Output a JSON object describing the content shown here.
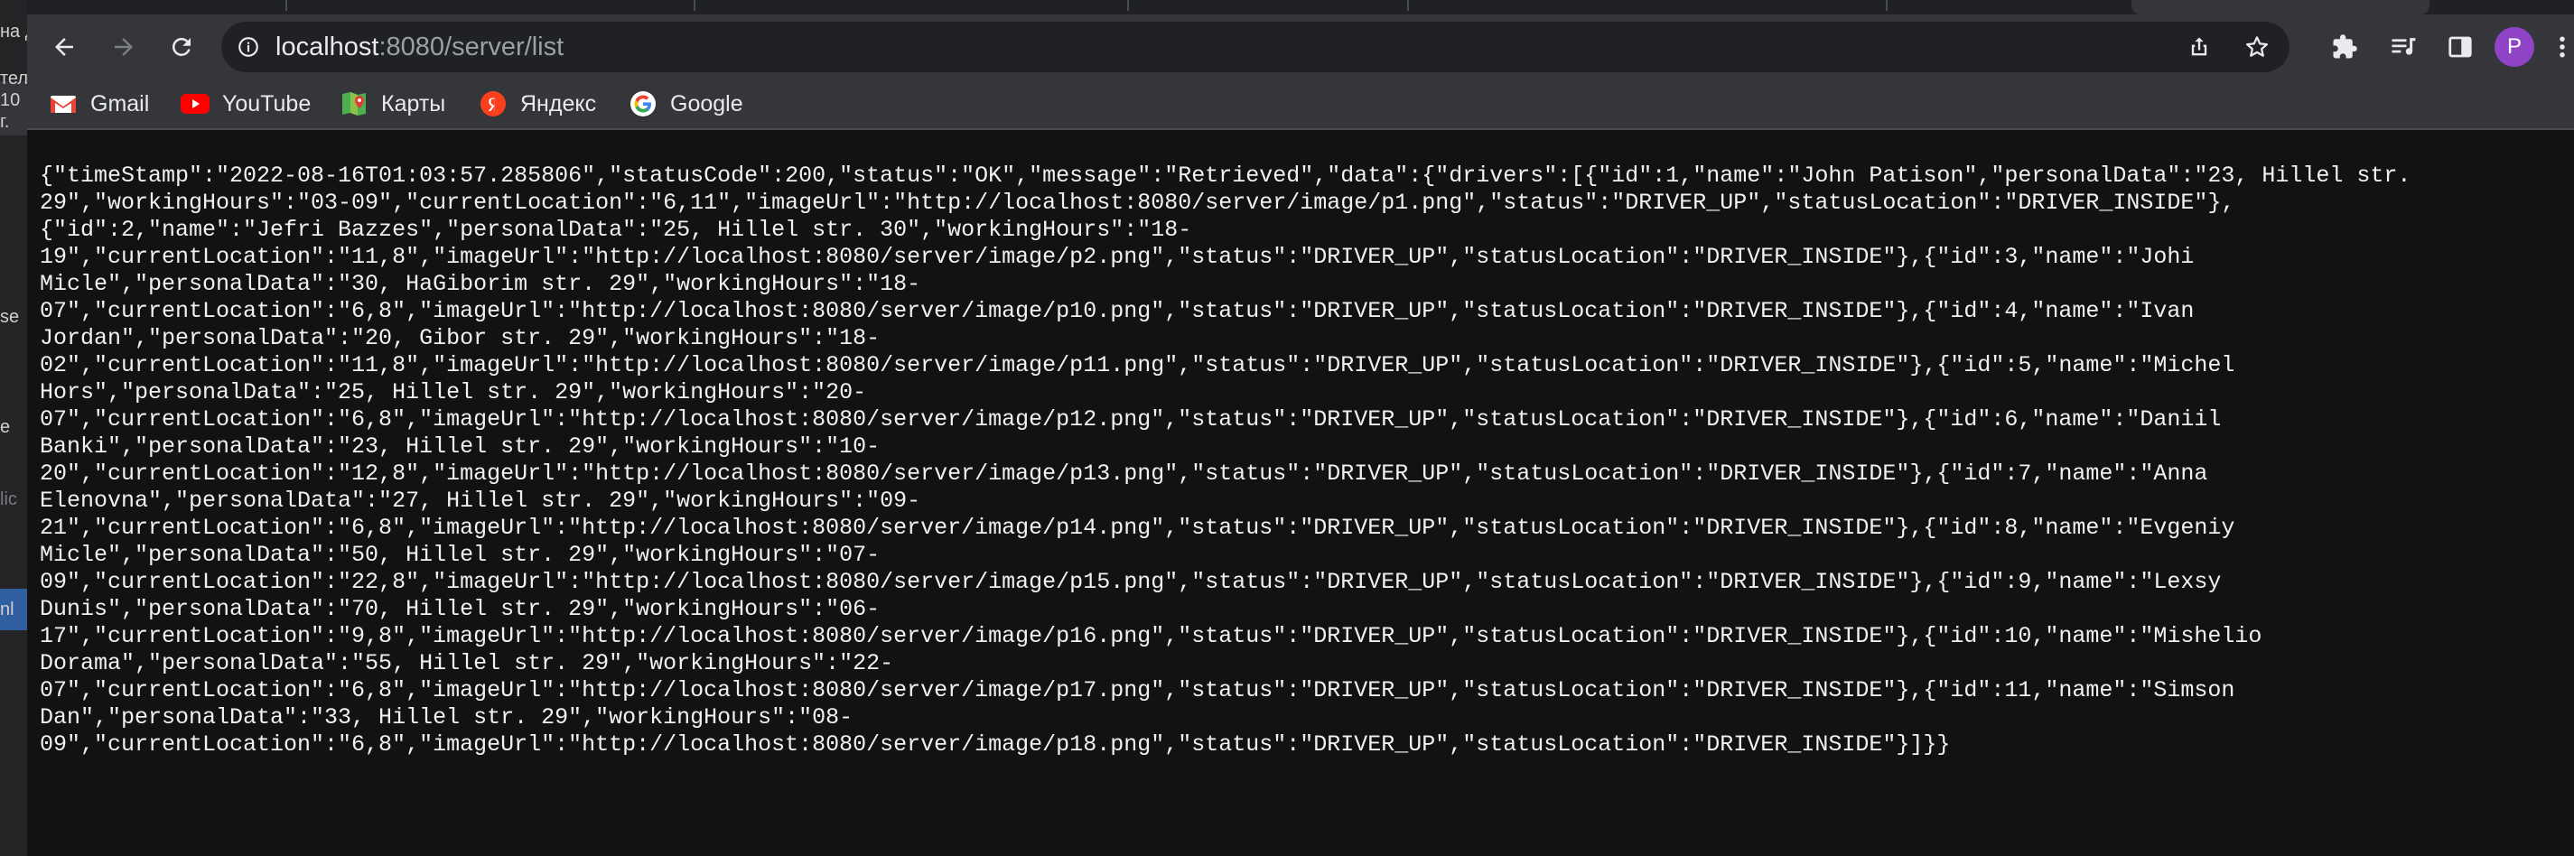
{
  "left_window_fragments": [
    "на д",
    "тел",
    "10",
    "г.",
    "se",
    "e",
    "lic",
    "nl"
  ],
  "browser": {
    "url_host": "localhost",
    "url_rest": ":8080/server/list",
    "profile_initial": "P",
    "toolbar_icons": [
      "back-icon",
      "forward-icon",
      "reload-icon",
      "site-info-icon",
      "share-icon",
      "bookmark-star-icon",
      "extensions-icon",
      "media-control-icon",
      "side-panel-icon",
      "profile-avatar",
      "menu-icon"
    ],
    "colors": {
      "toolbar": "#35363a",
      "omnibox": "#202124",
      "page": "#121212",
      "avatar": "#8e44c4"
    }
  },
  "bookmarks": [
    {
      "label": "Gmail",
      "icon": "gmail-icon"
    },
    {
      "label": "YouTube",
      "icon": "youtube-icon"
    },
    {
      "label": "Карты",
      "icon": "maps-icon"
    },
    {
      "label": "Яндекс",
      "icon": "yandex-icon"
    },
    {
      "label": "Google",
      "icon": "google-icon"
    }
  ],
  "json_lines": [
    "{\"timeStamp\":\"2022-08-16T01:03:57.285806\",\"statusCode\":200,\"status\":\"OK\",\"message\":\"Retrieved\",\"data\":{\"drivers\":[{\"id\":1,\"name\":\"John Patison\",\"personalData\":\"23, Hillel str.",
    "29\",\"workingHours\":\"03-09\",\"currentLocation\":\"6,11\",\"imageUrl\":\"http://localhost:8080/server/image/p1.png\",\"status\":\"DRIVER_UP\",\"statusLocation\":\"DRIVER_INSIDE\"},",
    "{\"id\":2,\"name\":\"Jefri Bazzes\",\"personalData\":\"25, Hillel str. 30\",\"workingHours\":\"18-",
    "19\",\"currentLocation\":\"11,8\",\"imageUrl\":\"http://localhost:8080/server/image/p2.png\",\"status\":\"DRIVER_UP\",\"statusLocation\":\"DRIVER_INSIDE\"},{\"id\":3,\"name\":\"Johi",
    "Micle\",\"personalData\":\"30, HaGiborim str. 29\",\"workingHours\":\"18-",
    "07\",\"currentLocation\":\"6,8\",\"imageUrl\":\"http://localhost:8080/server/image/p10.png\",\"status\":\"DRIVER_UP\",\"statusLocation\":\"DRIVER_INSIDE\"},{\"id\":4,\"name\":\"Ivan",
    "Jordan\",\"personalData\":\"20, Gibor str. 29\",\"workingHours\":\"18-",
    "02\",\"currentLocation\":\"11,8\",\"imageUrl\":\"http://localhost:8080/server/image/p11.png\",\"status\":\"DRIVER_UP\",\"statusLocation\":\"DRIVER_INSIDE\"},{\"id\":5,\"name\":\"Michel",
    "Hors\",\"personalData\":\"25, Hillel str. 29\",\"workingHours\":\"20-",
    "07\",\"currentLocation\":\"6,8\",\"imageUrl\":\"http://localhost:8080/server/image/p12.png\",\"status\":\"DRIVER_UP\",\"statusLocation\":\"DRIVER_INSIDE\"},{\"id\":6,\"name\":\"Daniil",
    "Banki\",\"personalData\":\"23, Hillel str. 29\",\"workingHours\":\"10-",
    "20\",\"currentLocation\":\"12,8\",\"imageUrl\":\"http://localhost:8080/server/image/p13.png\",\"status\":\"DRIVER_UP\",\"statusLocation\":\"DRIVER_INSIDE\"},{\"id\":7,\"name\":\"Anna",
    "Elenovna\",\"personalData\":\"27, Hillel str. 29\",\"workingHours\":\"09-",
    "21\",\"currentLocation\":\"6,8\",\"imageUrl\":\"http://localhost:8080/server/image/p14.png\",\"status\":\"DRIVER_UP\",\"statusLocation\":\"DRIVER_INSIDE\"},{\"id\":8,\"name\":\"Evgeniy",
    "Micle\",\"personalData\":\"50, Hillel str. 29\",\"workingHours\":\"07-",
    "09\",\"currentLocation\":\"22,8\",\"imageUrl\":\"http://localhost:8080/server/image/p15.png\",\"status\":\"DRIVER_UP\",\"statusLocation\":\"DRIVER_INSIDE\"},{\"id\":9,\"name\":\"Lexsy",
    "Dunis\",\"personalData\":\"70, Hillel str. 29\",\"workingHours\":\"06-",
    "17\",\"currentLocation\":\"9,8\",\"imageUrl\":\"http://localhost:8080/server/image/p16.png\",\"status\":\"DRIVER_UP\",\"statusLocation\":\"DRIVER_INSIDE\"},{\"id\":10,\"name\":\"Mishelio",
    "Dorama\",\"personalData\":\"55, Hillel str. 29\",\"workingHours\":\"22-",
    "07\",\"currentLocation\":\"6,8\",\"imageUrl\":\"http://localhost:8080/server/image/p17.png\",\"status\":\"DRIVER_UP\",\"statusLocation\":\"DRIVER_INSIDE\"},{\"id\":11,\"name\":\"Simson",
    "Dan\",\"personalData\":\"33, Hillel str. 29\",\"workingHours\":\"08-",
    "09\",\"currentLocation\":\"6,8\",\"imageUrl\":\"http://localhost:8080/server/image/p18.png\",\"status\":\"DRIVER_UP\",\"statusLocation\":\"DRIVER_INSIDE\"}]}}"
  ]
}
